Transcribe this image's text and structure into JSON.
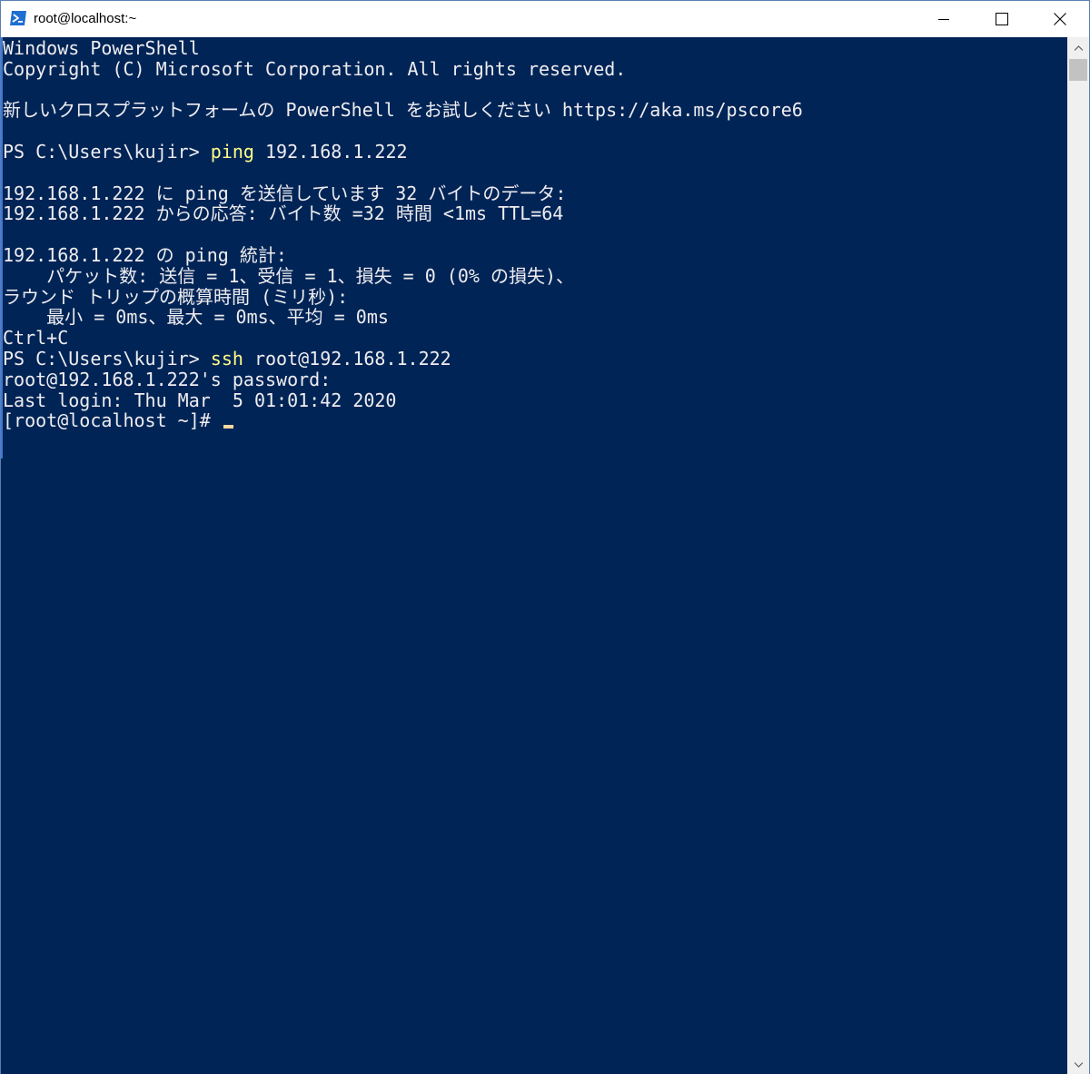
{
  "window": {
    "title": "root@localhost:~",
    "icon": "powershell-icon",
    "controls": {
      "minimize": "minimize-icon",
      "maximize": "maximize-icon",
      "close": "close-icon"
    }
  },
  "colors": {
    "console_background": "#012456",
    "console_text": "#eeedf0",
    "command_highlight": "#fffd87",
    "cursor": "#ffd7a0"
  },
  "console": {
    "lines": [
      {
        "text": "Windows PowerShell"
      },
      {
        "text": "Copyright (C) Microsoft Corporation. All rights reserved."
      },
      {
        "text": ""
      },
      {
        "text": "新しいクロスプラットフォームの PowerShell をお試しください https://aka.ms/pscore6"
      },
      {
        "text": ""
      },
      {
        "prompt": "PS C:\\Users\\kujir> ",
        "command": "ping",
        "args": " 192.168.1.222"
      },
      {
        "text": ""
      },
      {
        "text": "192.168.1.222 に ping を送信しています 32 バイトのデータ:"
      },
      {
        "text": "192.168.1.222 からの応答: バイト数 =32 時間 <1ms TTL=64"
      },
      {
        "text": ""
      },
      {
        "text": "192.168.1.222 の ping 統計:"
      },
      {
        "text": "    パケット数: 送信 = 1、受信 = 1、損失 = 0 (0% の損失)、"
      },
      {
        "text": "ラウンド トリップの概算時間 (ミリ秒):"
      },
      {
        "text": "    最小 = 0ms、最大 = 0ms、平均 = 0ms"
      },
      {
        "text": "Ctrl+C"
      },
      {
        "prompt": "PS C:\\Users\\kujir> ",
        "command": "ssh",
        "args": " root@192.168.1.222"
      },
      {
        "text": "root@192.168.1.222's password:"
      },
      {
        "text": "Last login: Thu Mar  5 01:01:42 2020"
      },
      {
        "text": "[root@localhost ~]# ",
        "cursor": true
      }
    ]
  }
}
